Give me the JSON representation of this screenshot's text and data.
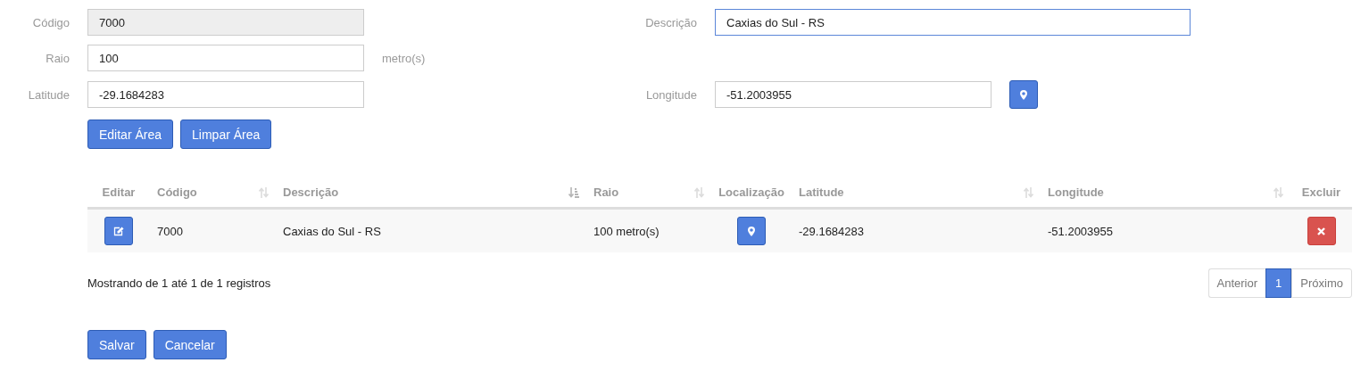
{
  "form": {
    "codigo": {
      "label": "Código",
      "value": "7000",
      "disabled": true,
      "focused": false
    },
    "descricao": {
      "label": "Descrição",
      "value": "Caxias do Sul - RS",
      "disabled": false,
      "focused": true
    },
    "raio": {
      "label": "Raio",
      "value": "100",
      "unit": "metro(s)",
      "disabled": false,
      "focused": false
    },
    "latitude": {
      "label": "Latitude",
      "value": "-29.1684283",
      "disabled": false,
      "focused": false
    },
    "longitude": {
      "label": "Longitude",
      "value": "-51.2003955",
      "disabled": false,
      "focused": false
    },
    "buttons": [
      "Editar Área",
      "Limpar Área"
    ]
  },
  "table": {
    "columns": [
      {
        "label": "Editar",
        "sortable": false,
        "sorted": false
      },
      {
        "label": "Código",
        "sortable": true,
        "sorted": false
      },
      {
        "label": "Descrição",
        "sortable": true,
        "sorted": true
      },
      {
        "label": "Raio",
        "sortable": true,
        "sorted": false
      },
      {
        "label": "Localização",
        "sortable": false,
        "sorted": false
      },
      {
        "label": "Latitude",
        "sortable": true,
        "sorted": false
      },
      {
        "label": "Longitude",
        "sortable": true,
        "sorted": false
      },
      {
        "label": "Excluir",
        "sortable": false,
        "sorted": false
      }
    ],
    "rows": [
      {
        "cells": [
          {
            "kind": "edit"
          },
          {
            "kind": "text",
            "text": "7000"
          },
          {
            "kind": "text",
            "text": "Caxias do Sul - RS"
          },
          {
            "kind": "text",
            "text": "100 metro(s)"
          },
          {
            "kind": "locate"
          },
          {
            "kind": "text",
            "text": "-29.1684283"
          },
          {
            "kind": "text",
            "text": "-51.2003955"
          },
          {
            "kind": "delete"
          }
        ]
      }
    ]
  },
  "pagination": {
    "info": "Mostrando de 1 até 1 de 1 registros",
    "previous": "Anterior",
    "pages": [
      {
        "label": "1",
        "selected": true
      }
    ],
    "next": "Próximo"
  },
  "buttons": [
    "Salvar",
    "Cancelar"
  ]
}
